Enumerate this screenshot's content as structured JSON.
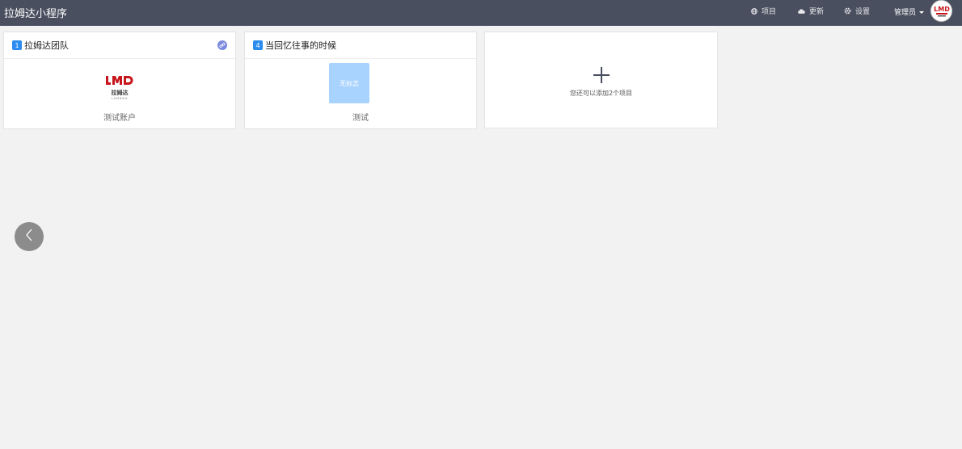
{
  "app": {
    "title": "拉姆达小程序"
  },
  "nav": {
    "projects": "项目",
    "updates": "更新",
    "settings": "设置",
    "user": "管理员"
  },
  "projects": [
    {
      "number": "1",
      "name": "拉姆达团队",
      "logo_text": "拉姆达",
      "logo_sub": "LAMBDA",
      "caption": "测试账户"
    },
    {
      "number": "4",
      "name": "当回忆往事的时候",
      "logo_placeholder": "无标志",
      "caption": "测试"
    }
  ],
  "add_card": {
    "text": "您还可以添加2个项目"
  },
  "colors": {
    "topbar": "#4a4f5f",
    "badge": "#2d8cf0",
    "logo_red": "#c8161d",
    "placeholder_logo": "#a9d3ff"
  }
}
